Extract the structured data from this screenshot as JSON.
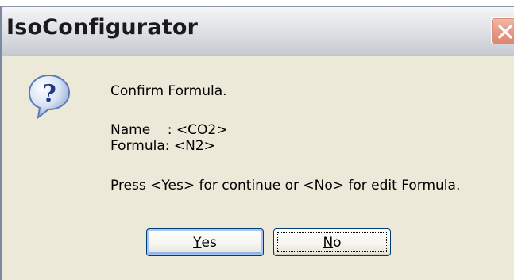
{
  "window": {
    "title": "IsoConfigurator",
    "close_icon": "close-icon"
  },
  "dialog": {
    "icon": "question-icon",
    "heading": "Confirm Formula.",
    "name_line": "Name    : <CO2>",
    "formula_line": "Formula: <N2>",
    "instruction": "Press <Yes> for continue or <No> for edit Formula."
  },
  "buttons": {
    "yes": {
      "mnemonic": "Y",
      "rest": "es"
    },
    "no": {
      "mnemonic": "N",
      "rest": "o"
    }
  }
}
